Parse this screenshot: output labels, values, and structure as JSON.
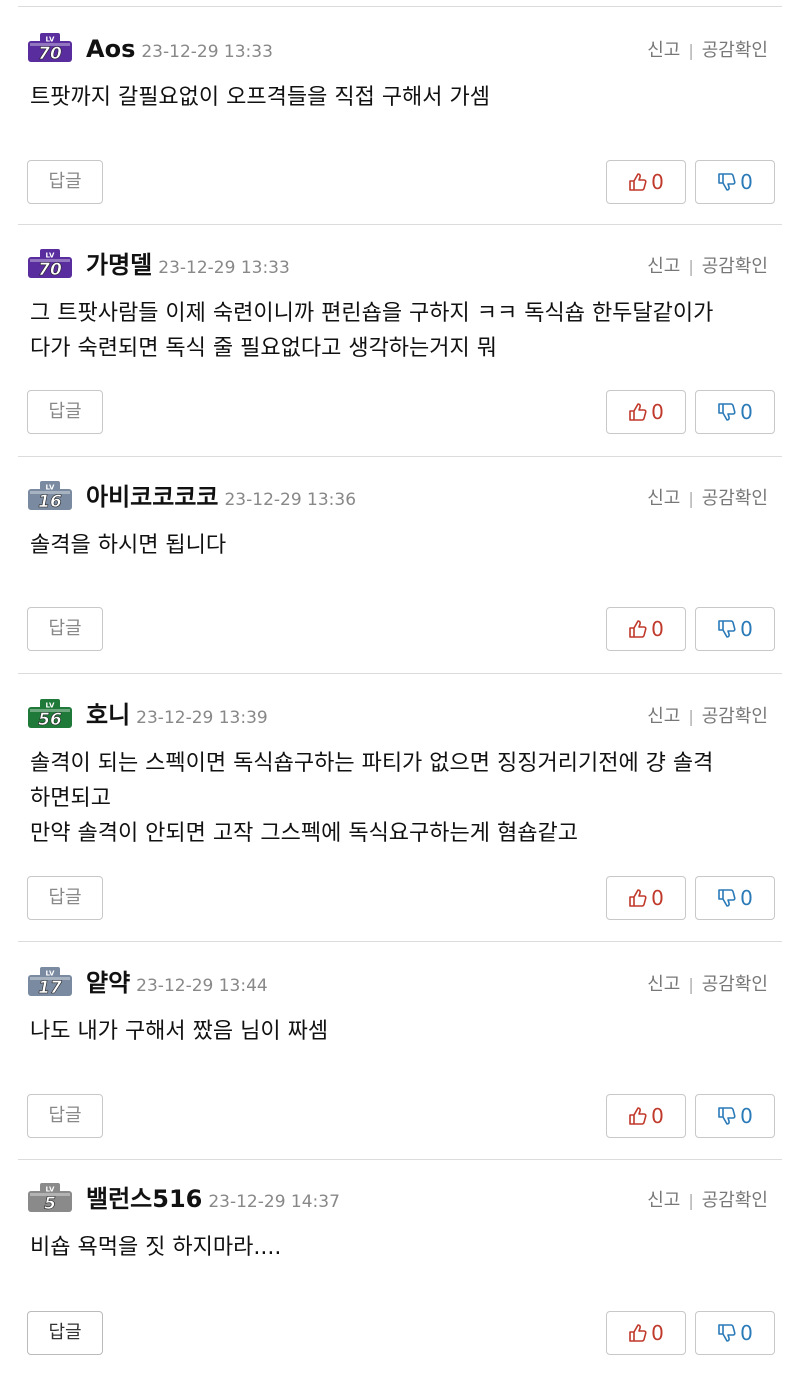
{
  "colors": {
    "lv70": "#5a2d9e",
    "lv16": "#7a8aa0",
    "lv56": "#1f7a3a",
    "lv17": "#7a8aa0",
    "lv5": "#8a8a8a",
    "upvote": "#c0392b",
    "downvote": "#2a7ab8"
  },
  "ui": {
    "report": "신고",
    "separator": "|",
    "empathy_check": "공감확인",
    "reply": "답글",
    "lv_tag": "LV"
  },
  "comments": [
    {
      "level": "70",
      "nickname": "Aos",
      "date": "23-12-29 13:33",
      "lines": [
        "트팟까지 갈필요없이 오프격들을 직접 구해서 가셈"
      ],
      "upvotes": "0",
      "downvotes": "0"
    },
    {
      "level": "70",
      "nickname": "가명델",
      "date": "23-12-29 13:33",
      "lines": [
        "그 트팟사람들 이제 숙련이니까 편린숍을 구하지 ㅋㅋ 독식숍 한두달같이가",
        "다가 숙련되면 독식 줄 필요없다고 생각하는거지 뭐"
      ],
      "upvotes": "0",
      "downvotes": "0"
    },
    {
      "level": "16",
      "nickname": "아비코코코코",
      "date": "23-12-29 13:36",
      "lines": [
        "솔격을 하시면 됩니다"
      ],
      "upvotes": "0",
      "downvotes": "0"
    },
    {
      "level": "56",
      "nickname": "호니",
      "date": "23-12-29 13:39",
      "lines": [
        "솔격이 되는 스펙이면 독식숍구하는 파티가 없으면 징징거리기전에 걍 솔격",
        "하면되고",
        "만약 솔격이 안되면 고작 그스펙에 독식요구하는게 혐숍같고"
      ],
      "upvotes": "0",
      "downvotes": "0"
    },
    {
      "level": "17",
      "nickname": "얕약",
      "date": "23-12-29 13:44",
      "lines": [
        "나도 내가 구해서 짰음 님이 짜셈"
      ],
      "upvotes": "0",
      "downvotes": "0"
    },
    {
      "level": "5",
      "nickname": "밸런스516",
      "date": "23-12-29 14:37",
      "lines": [
        "비숍 욕먹을 짓 하지마라...."
      ],
      "upvotes": "0",
      "downvotes": "0"
    }
  ]
}
